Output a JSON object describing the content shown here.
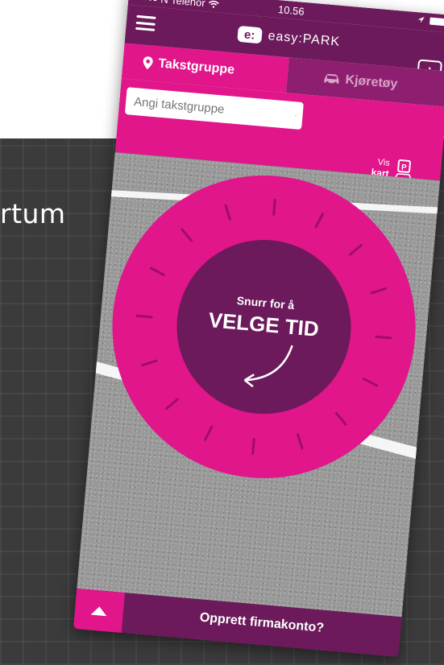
{
  "background": {
    "word": "rtum"
  },
  "colors": {
    "brand": "#e0168a",
    "dark": "#6c1a5b",
    "tab_inactive": "#8e1f70",
    "asphalt": "#999999",
    "dial_center": "#6c1a5b"
  },
  "status_bar": {
    "carrier": "N Telenor",
    "time": "10.56"
  },
  "header": {
    "logo_mark": "e:",
    "logo_text": "easy:PARK",
    "info_label": "i"
  },
  "tabs": [
    {
      "label": "Takstgruppe",
      "icon": "location-pin-icon",
      "active": true
    },
    {
      "label": "Kjøretøy",
      "icon": "car-icon",
      "active": false
    }
  ],
  "search": {
    "placeholder": "Angi takstgruppe",
    "value": "",
    "flag": "norway-flag"
  },
  "map_link": {
    "vis": "Vis",
    "kart": "kart",
    "icon": "parking-map-icon"
  },
  "dial": {
    "line1": "Snurr for å",
    "line2": "VELGE TID",
    "icon": "curved-arrow-icon"
  },
  "bottom": {
    "cta_label": "Opprett firmakonto?",
    "up_icon": "up-arrow-icon"
  }
}
